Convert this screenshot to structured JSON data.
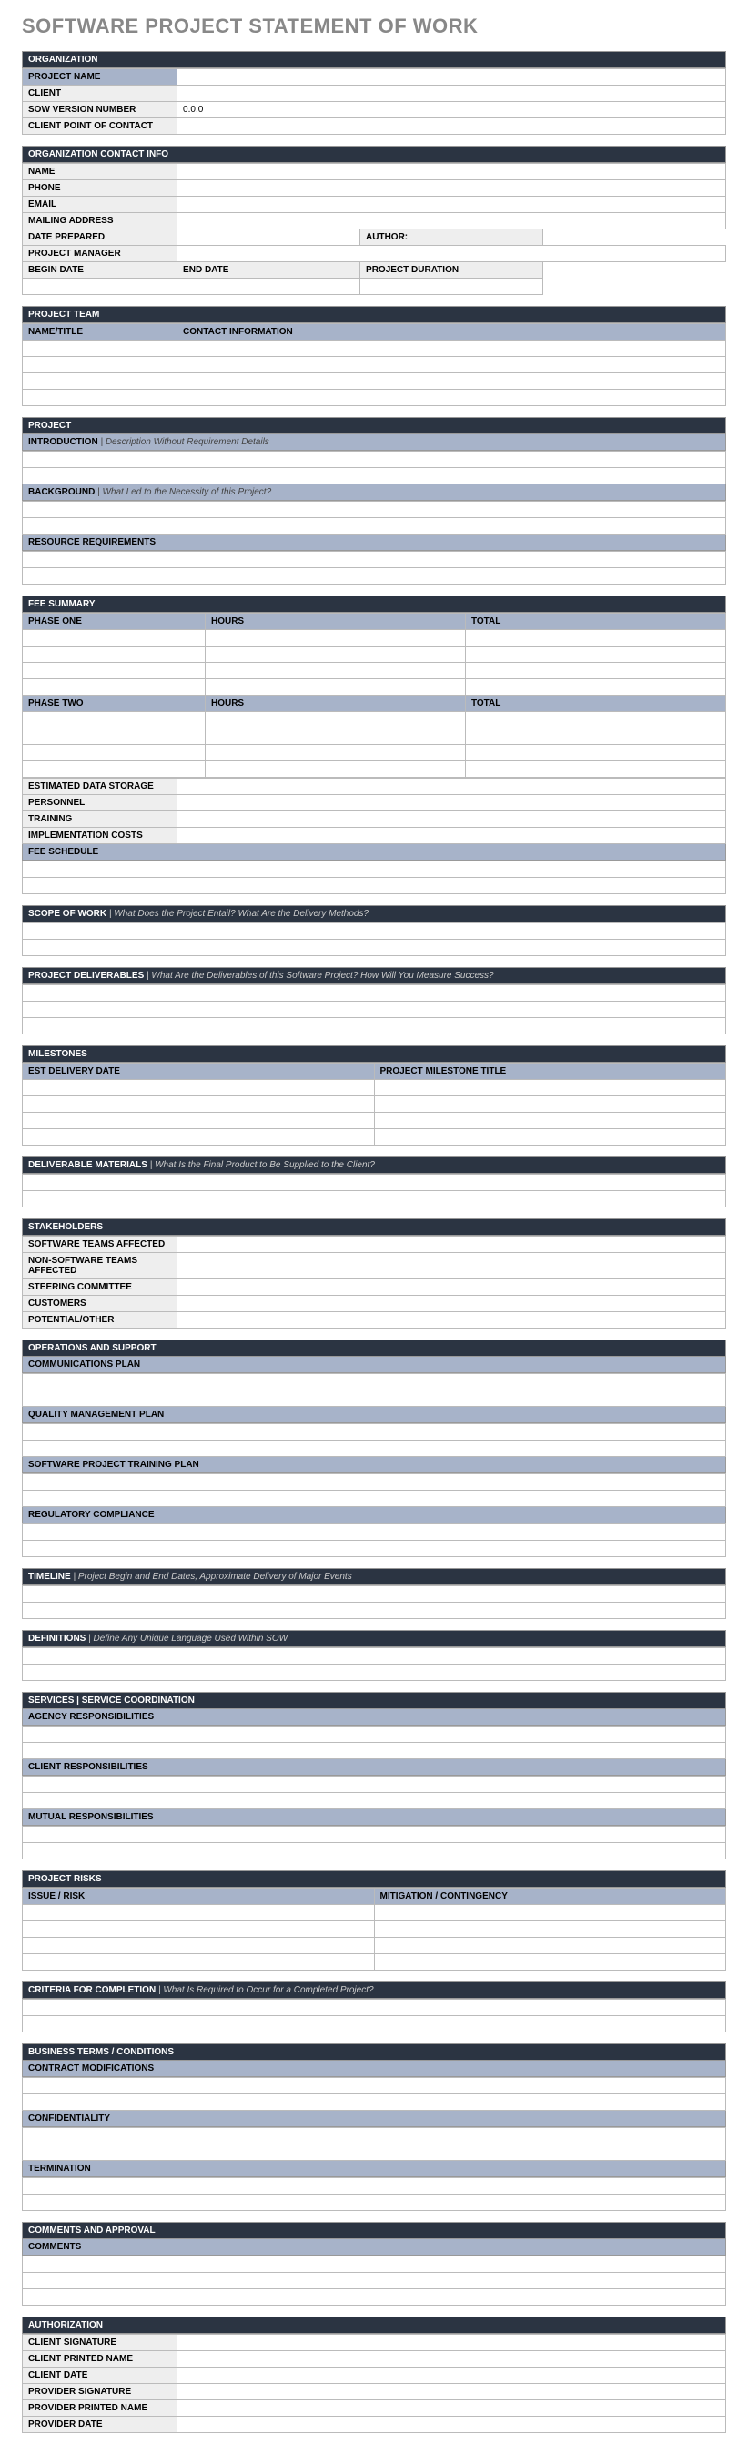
{
  "title": "SOFTWARE PROJECT STATEMENT OF WORK",
  "org": {
    "header": "ORGANIZATION",
    "projectName": "PROJECT NAME",
    "client": "CLIENT",
    "sowVersion": "SOW VERSION NUMBER",
    "sowVersionVal": "0.0.0",
    "clientPOC": "CLIENT POINT OF CONTACT"
  },
  "contact": {
    "header": "ORGANIZATION CONTACT INFO",
    "name": "NAME",
    "phone": "PHONE",
    "email": "EMAIL",
    "mailing": "MAILING ADDRESS",
    "datePrepared": "DATE PREPARED",
    "author": "AUTHOR:",
    "projectManager": "PROJECT MANAGER",
    "beginDate": "BEGIN DATE",
    "endDate": "END DATE",
    "duration": "PROJECT DURATION"
  },
  "team": {
    "header": "PROJECT TEAM",
    "nameTitle": "NAME/TITLE",
    "contactInfo": "CONTACT INFORMATION"
  },
  "project": {
    "header": "PROJECT",
    "intro": "INTRODUCTION",
    "introSub": " |  Description Without Requirement Details",
    "background": "BACKGROUND",
    "backgroundSub": " |  What Led to the Necessity of this Project?",
    "resource": "RESOURCE REQUIREMENTS"
  },
  "fee": {
    "header": "FEE SUMMARY",
    "phaseOne": "PHASE ONE",
    "hours": "HOURS",
    "total": "TOTAL",
    "phaseTwo": "PHASE TWO",
    "estStorage": "ESTIMATED DATA STORAGE",
    "personnel": "PERSONNEL",
    "training": "TRAINING",
    "implCosts": "IMPLEMENTATION COSTS",
    "feeSchedule": "FEE SCHEDULE"
  },
  "scope": {
    "header": "SCOPE OF WORK",
    "sub": "  |  What Does the Project Entail? What Are the Delivery Methods?"
  },
  "deliverables": {
    "header": "PROJECT DELIVERABLES",
    "sub": "  |  What Are the Deliverables of this Software Project? How Will You Measure Success?"
  },
  "milestones": {
    "header": "MILESTONES",
    "estDate": "EST DELIVERY DATE",
    "milestoneTitle": "PROJECT MILESTONE TITLE"
  },
  "delivMaterials": {
    "header": "DELIVERABLE MATERIALS",
    "sub": "  |  What Is the Final Product to Be Supplied to the Client?"
  },
  "stakeholders": {
    "header": "STAKEHOLDERS",
    "software": "SOFTWARE TEAMS AFFECTED",
    "nonsoftware": "NON-SOFTWARE TEAMS AFFECTED",
    "steering": "STEERING COMMITTEE",
    "customers": "CUSTOMERS",
    "potential": "POTENTIAL/OTHER"
  },
  "ops": {
    "header": "OPERATIONS AND SUPPORT",
    "comm": "COMMUNICATIONS PLAN",
    "quality": "QUALITY MANAGEMENT PLAN",
    "training": "SOFTWARE PROJECT TRAINING PLAN",
    "regulatory": "REGULATORY COMPLIANCE"
  },
  "timeline": {
    "header": "TIMELINE",
    "sub": "  |  Project Begin and End Dates, Approximate Delivery of Major Events"
  },
  "definitions": {
    "header": "DEFINITIONS",
    "sub": "  |  Define Any Unique Language Used Within SOW"
  },
  "services": {
    "header": "SERVICES  |  SERVICE COORDINATION",
    "agency": "AGENCY RESPONSIBILITIES",
    "client": "CLIENT RESPONSIBILITIES",
    "mutual": "MUTUAL RESPONSIBILITIES"
  },
  "risks": {
    "header": "PROJECT RISKS",
    "issue": "ISSUE / RISK",
    "mitigation": "MITIGATION / CONTINGENCY"
  },
  "criteria": {
    "header": "CRITERIA FOR COMPLETION",
    "sub": "  |  What Is Required to Occur for a Completed Project?"
  },
  "terms": {
    "header": "BUSINESS TERMS / CONDITIONS",
    "contract": "CONTRACT MODIFICATIONS",
    "conf": "CONFIDENTIALITY",
    "term": "TERMINATION"
  },
  "comments": {
    "header": "COMMENTS AND APPROVAL",
    "comments": "COMMENTS"
  },
  "auth": {
    "header": "AUTHORIZATION",
    "clientSig": "CLIENT SIGNATURE",
    "clientName": "CLIENT PRINTED NAME",
    "clientDate": "CLIENT DATE",
    "providerSig": "PROVIDER SIGNATURE",
    "providerName": "PROVIDER PRINTED NAME",
    "providerDate": "PROVIDER DATE"
  }
}
